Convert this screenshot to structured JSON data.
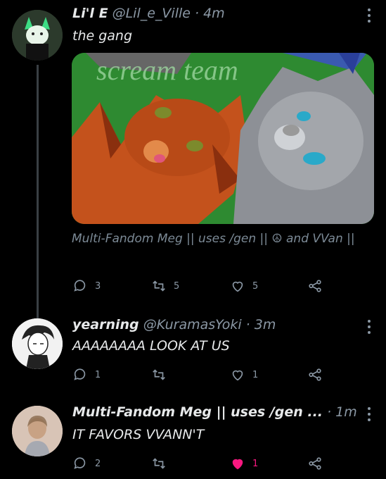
{
  "tweets": [
    {
      "name": "Li'l E",
      "handle": "@Lil_e_Ville",
      "time": "4m",
      "text": "the gang",
      "media_text": "scream team",
      "tagline": "Multi-Fandom Meg || uses /gen || ☮ and VVan ||",
      "reply_count": "3",
      "retweet_count": "5",
      "like_count": "5"
    },
    {
      "name": "yearning",
      "handle": "@KuramasYoki",
      "time": "3m",
      "text": "AAAAAAAA LOOK AT US",
      "reply_count": "1",
      "retweet_count": "",
      "like_count": "1"
    },
    {
      "name": "Multi-Fandom Meg || uses /gen ...",
      "handle": "",
      "time": "1m",
      "text": "IT FAVORS VVANN'T",
      "reply_count": "2",
      "retweet_count": "",
      "like_count": "1",
      "liked": true
    }
  ],
  "colors": {
    "background": "#000000",
    "muted": "#8b98a5",
    "like": "#f91880",
    "thread": "#3a3f44"
  },
  "icons": [
    "reply-icon",
    "retweet-icon",
    "like-icon",
    "share-icon",
    "more-icon"
  ]
}
